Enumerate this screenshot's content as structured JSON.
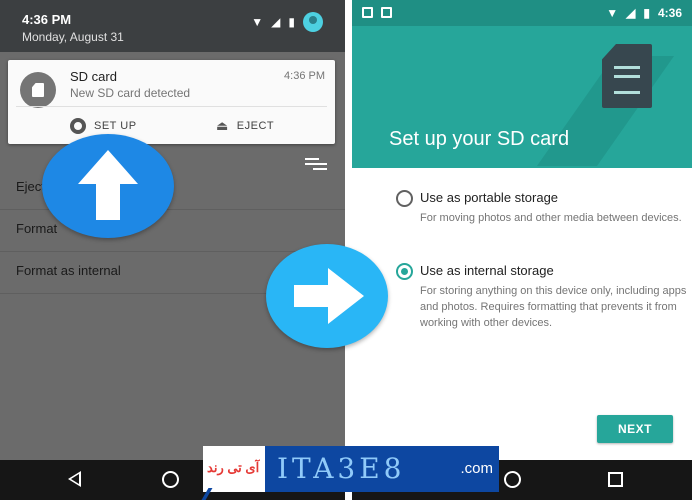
{
  "left_screen": {
    "status": {
      "time": "4:36 PM",
      "date": "Monday, August 31"
    },
    "notification": {
      "title": "SD card",
      "time": "4:36 PM",
      "subtitle": "New SD card detected",
      "actions": [
        {
          "label": "SET UP",
          "icon": "gear-icon"
        },
        {
          "label": "EJECT",
          "icon": "eject-icon"
        }
      ]
    },
    "menu_items": [
      "Eject",
      "Format",
      "Format as internal"
    ]
  },
  "right_screen": {
    "status_time": "4:36",
    "title": "Set up your SD card",
    "options": [
      {
        "label": "Use as portable storage",
        "description": "For moving photos and other media between devices.",
        "selected": false
      },
      {
        "label": "Use as internal storage",
        "description": "For storing anything on this device only, including apps and photos. Requires formatting that prevents it from working with other devices.",
        "selected": true
      }
    ],
    "next_label": "NEXT"
  },
  "arrows": {
    "up_color": "#1e88e5",
    "right_color": "#29b6f6"
  },
  "watermark": {
    "left_text": "آی تی رند",
    "logo_text": "ITA3E8",
    "suffix": ".com"
  },
  "colors": {
    "accent": "#26a69a",
    "header": "#26a69a",
    "shade": "#6b6b6b"
  }
}
